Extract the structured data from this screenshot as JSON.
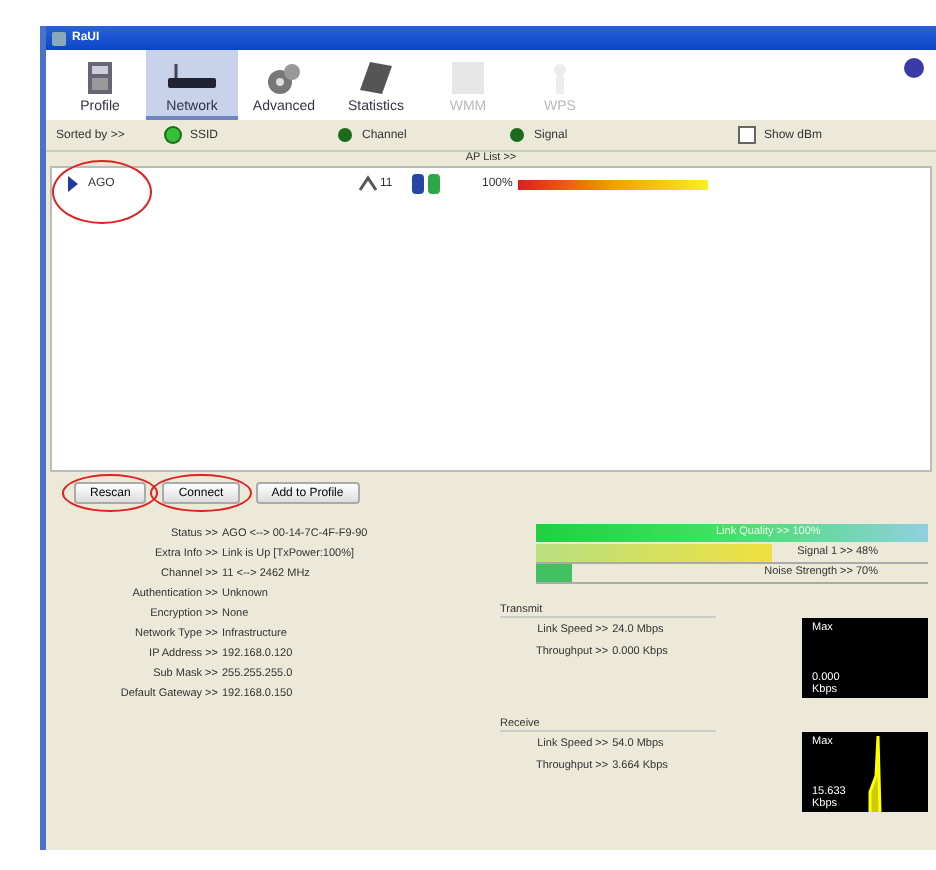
{
  "window": {
    "title": "RaUI"
  },
  "toolbar": [
    {
      "label": "Profile",
      "selected": false,
      "disabled": false
    },
    {
      "label": "Network",
      "selected": true,
      "disabled": false
    },
    {
      "label": "Advanced",
      "selected": false,
      "disabled": false
    },
    {
      "label": "Statistics",
      "selected": false,
      "disabled": false
    },
    {
      "label": "WMM",
      "selected": false,
      "disabled": true
    },
    {
      "label": "WPS",
      "selected": false,
      "disabled": true
    }
  ],
  "sort": {
    "label": "Sorted by >>",
    "options": [
      {
        "label": "SSID",
        "selected": true
      },
      {
        "label": "Channel",
        "selected": false
      },
      {
        "label": "Signal",
        "selected": false
      }
    ],
    "show_dbm": {
      "label": "Show dBm",
      "checked": false
    }
  },
  "ap_list": {
    "label": "AP List >>",
    "rows": [
      {
        "ssid": "AGO",
        "channel": "11",
        "signal": "100%",
        "circled": true
      }
    ]
  },
  "buttons": [
    {
      "label": "Rescan",
      "circled": true
    },
    {
      "label": "Connect",
      "circled": true
    },
    {
      "label": "Add to Profile",
      "circled": false
    }
  ],
  "details": [
    {
      "label": "Status >>",
      "value": "AGO <--> 00-14-7C-4F-F9-90"
    },
    {
      "label": "Extra Info >>",
      "value": "Link is Up [TxPower:100%]"
    },
    {
      "label": "Channel >>",
      "value": "11 <--> 2462 MHz"
    },
    {
      "label": "Authentication >>",
      "value": "Unknown"
    },
    {
      "label": "Encryption >>",
      "value": "None"
    },
    {
      "label": "Network Type >>",
      "value": "Infrastructure"
    },
    {
      "label": "IP Address >>",
      "value": "192.168.0.120"
    },
    {
      "label": "Sub Mask >>",
      "value": "255.255.255.0"
    },
    {
      "label": "Default Gateway >>",
      "value": "192.168.0.150"
    }
  ],
  "quality": [
    {
      "kind": "quality",
      "label": "Link Quality >> 100%",
      "level": 1
    },
    {
      "kind": "signal",
      "label": "Signal 1 >> 48%",
      "level": 0.6
    },
    {
      "kind": "noise",
      "label": "Noise Strength >> 70%",
      "level": 0.09
    }
  ],
  "traffic": [
    {
      "title": "Transmit",
      "rows": [
        {
          "label": "Link Speed >>",
          "value": "24.0 Mbps"
        },
        {
          "label": "Throughput >>",
          "value": "0.000 Kbps"
        }
      ],
      "graph": {
        "max": "Max",
        "value": "0.000",
        "unit": "Kbps",
        "spike": false
      }
    },
    {
      "title": "Receive",
      "rows": [
        {
          "label": "Link Speed >>",
          "value": "54.0 Mbps"
        },
        {
          "label": "Throughput >>",
          "value": "3.664 Kbps"
        }
      ],
      "graph": {
        "max": "Max",
        "value": "15.633",
        "unit": "Kbps",
        "spike": true
      }
    }
  ]
}
